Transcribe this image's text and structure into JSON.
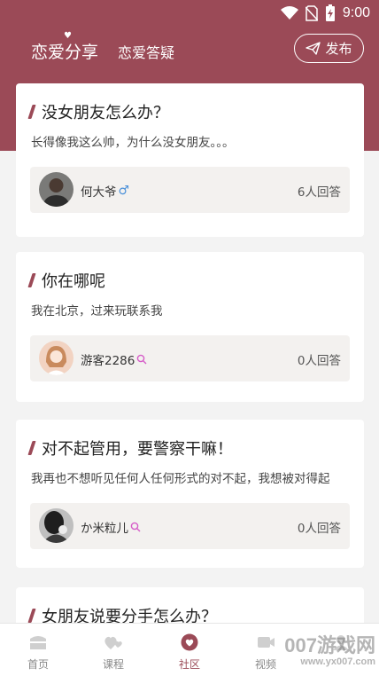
{
  "status_bar": {
    "time": "9:00",
    "icons": [
      "wifi-icon",
      "no-sim-icon",
      "battery-charging-icon"
    ]
  },
  "header": {
    "tabs": [
      {
        "label": "恋爱分享",
        "active": true
      },
      {
        "label": "恋爱答疑",
        "active": false
      }
    ],
    "post_button": {
      "label": "发布",
      "icon": "paper-plane-icon"
    }
  },
  "questions": [
    {
      "title": "没女朋友怎么办？",
      "desc": "长得像我这么帅，为什么没女朋友。。。",
      "user": "何大爷",
      "gender": "male",
      "answers": "6人回答"
    },
    {
      "title": "你在哪呢",
      "desc": "我在北京，过来玩联系我",
      "user": "游客2286",
      "gender": "female",
      "answers": "0人回答"
    },
    {
      "title": "对不起管用，要警察干嘛！",
      "desc": "我再也不想听见任何人任何形式的对不起，我想被对得起",
      "user": "か米粒儿",
      "gender": "female",
      "answers": "0人回答"
    },
    {
      "title": "女朋友说要分手怎么办？"
    }
  ],
  "tabbar": [
    {
      "label": "首页",
      "icon": "home-icon"
    },
    {
      "label": "课程",
      "icon": "course-icon"
    },
    {
      "label": "社区",
      "icon": "community-icon",
      "active": true
    },
    {
      "label": "视频",
      "icon": "video-icon"
    },
    {
      "label": "",
      "icon": "profile-icon"
    }
  ],
  "watermark": {
    "text": "007游戏网",
    "sub": "www.yx007.com"
  },
  "colors": {
    "brand": "#9b4a57",
    "male": "#4a90d9",
    "female": "#d65cc8"
  }
}
